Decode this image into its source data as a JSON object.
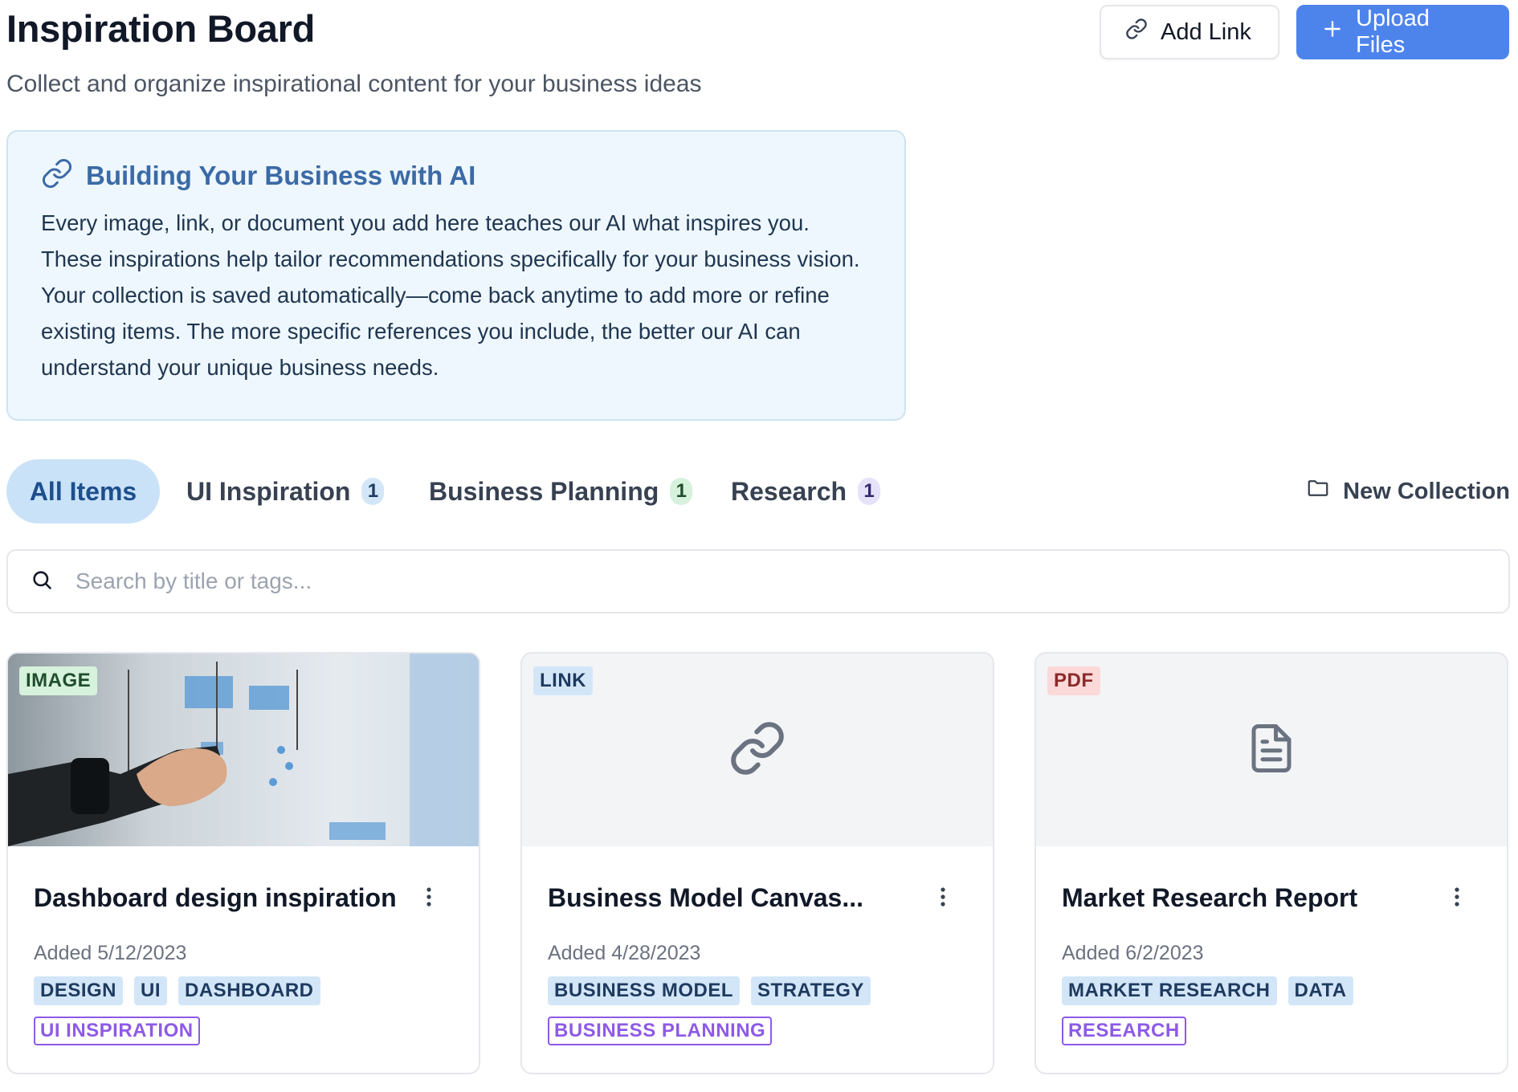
{
  "header": {
    "title": "Inspiration Board",
    "subtitle": "Collect and organize inspirational content for your business ideas",
    "add_link_label": "Add Link",
    "upload_label": "Upload Files"
  },
  "info": {
    "title": "Building Your Business with AI",
    "body": "Every image, link, or document you add here teaches our AI what inspires you. These inspirations help tailor recommendations specifically for your business vision. Your collection is saved automatically—come back anytime to add more or refine existing items. The more specific references you include, the better our AI can understand your unique business needs."
  },
  "tabs": {
    "all": "All Items",
    "items": [
      {
        "label": "UI Inspiration",
        "count": "1"
      },
      {
        "label": "Business Planning",
        "count": "1"
      },
      {
        "label": "Research",
        "count": "1"
      }
    ],
    "new_collection": "New Collection"
  },
  "search": {
    "placeholder": "Search by title or tags..."
  },
  "cards": [
    {
      "type": "IMAGE",
      "title": "Dashboard design inspiration",
      "date": "Added 5/12/2023",
      "tags": [
        "DESIGN",
        "UI",
        "DASHBOARD"
      ],
      "collection": "UI INSPIRATION"
    },
    {
      "type": "LINK",
      "title": "Business Model Canvas...",
      "date": "Added 4/28/2023",
      "tags": [
        "BUSINESS MODEL",
        "STRATEGY"
      ],
      "collection": "BUSINESS PLANNING"
    },
    {
      "type": "PDF",
      "title": "Market Research Report",
      "date": "Added 6/2/2023",
      "tags": [
        "MARKET RESEARCH",
        "DATA"
      ],
      "collection": "RESEARCH"
    }
  ],
  "colors": {
    "primary": "#4d84ec",
    "info_bg": "#eef7fd",
    "info_title": "#3b6aa6",
    "tab_active_bg": "#c9e2f7",
    "collection_tag": "#8e5ae6"
  }
}
